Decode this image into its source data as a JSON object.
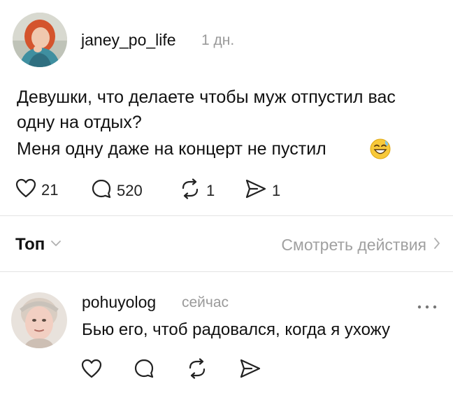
{
  "post": {
    "username": "janey_po_life",
    "time": "1 дн.",
    "text_line1": "Девушки, что делаете чтобы муж отпустил вас",
    "text_line2": "одну на отдых?",
    "text_line3": "Меня одну даже на концерт не пустил",
    "emoji_icon": "grinning-sweat-emoji",
    "actions": {
      "likes": "21",
      "comments": "520",
      "reposts": "1",
      "shares": "1"
    }
  },
  "replies_bar": {
    "sort_label": "Топ",
    "activity_label": "Смотреть действия"
  },
  "reply": {
    "username": "pohuyolog",
    "time": "сейчас",
    "text": "Бью его, чтоб радовался, когда я ухожу"
  },
  "colors": {
    "text": "#111111",
    "muted": "#9a9a9a",
    "divider": "#e3e3e3"
  }
}
